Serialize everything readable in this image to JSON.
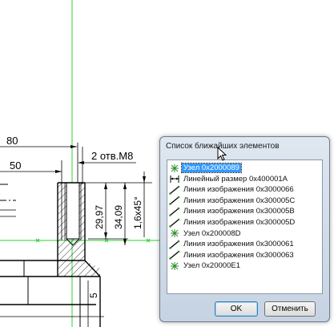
{
  "drawing": {
    "dim_80": "80",
    "dim_50": "50",
    "dim_holes": "2 отв.М8",
    "dim_29_97": "29,97",
    "dim_34_09": "34,09",
    "dim_chamfer": "1,6x45°",
    "dim_5": "5"
  },
  "dialog": {
    "title": "Список ближайших элементов",
    "items": [
      {
        "icon": "node-icon",
        "label": "Узел 0x2000089",
        "selected": true
      },
      {
        "icon": "linear-dimension-icon",
        "label": "Линейный размер 0x400001A",
        "selected": false
      },
      {
        "icon": "image-line-icon",
        "label": "Линия изображения 0x3000066",
        "selected": false
      },
      {
        "icon": "image-line-icon",
        "label": "Линия изображения 0x300005C",
        "selected": false
      },
      {
        "icon": "image-line-icon",
        "label": "Линия изображения 0x300005B",
        "selected": false
      },
      {
        "icon": "image-line-icon",
        "label": "Линия изображения 0x300005D",
        "selected": false
      },
      {
        "icon": "node-icon",
        "label": "Узел 0x200008D",
        "selected": false
      },
      {
        "icon": "image-line-icon",
        "label": "Линия изображения 0x3000061",
        "selected": false
      },
      {
        "icon": "image-line-icon",
        "label": "Линия изображения 0x3000063",
        "selected": false
      },
      {
        "icon": "node-icon",
        "label": "Узел 0x20000E1",
        "selected": false
      }
    ],
    "ok_label": "OK",
    "cancel_label": "Отменить"
  }
}
